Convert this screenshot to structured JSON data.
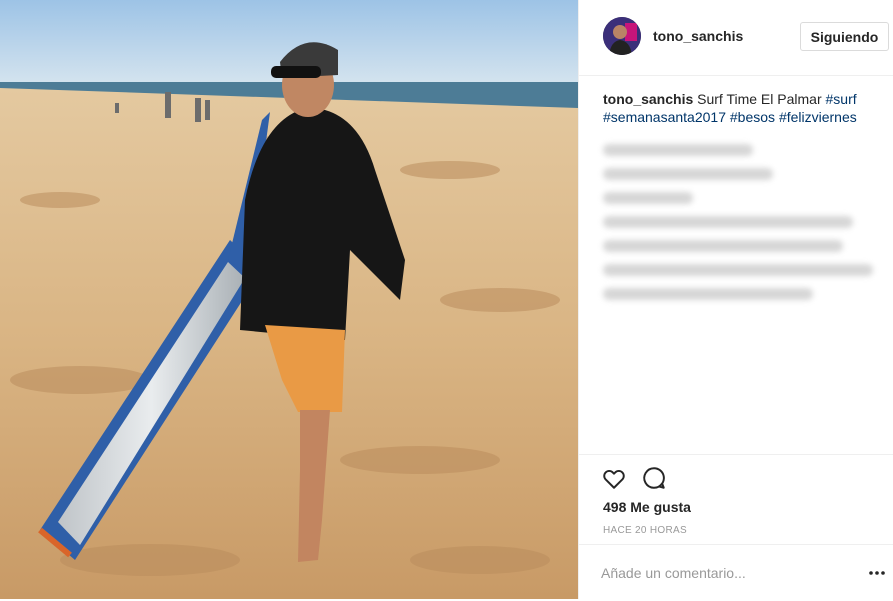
{
  "post": {
    "username": "tono_sanchis",
    "follow_label": "Siguiendo",
    "caption": {
      "username": "tono_sanchis",
      "text": " Surf Time El Palmar ",
      "tags": [
        "#surf",
        "#semanasanta2017",
        "#besos",
        "#felizviernes"
      ]
    },
    "likes_label": "498 Me gusta",
    "time_label": "HACE 20 HORAS",
    "comment_placeholder": "Añade un comentario...",
    "icons": {
      "like": "heart-icon",
      "comment": "speech-bubble-icon",
      "more": "more-options-icon"
    },
    "colors": {
      "hashtag": "#003569",
      "text": "#262626",
      "muted": "#999999",
      "divider": "#efefef"
    }
  }
}
